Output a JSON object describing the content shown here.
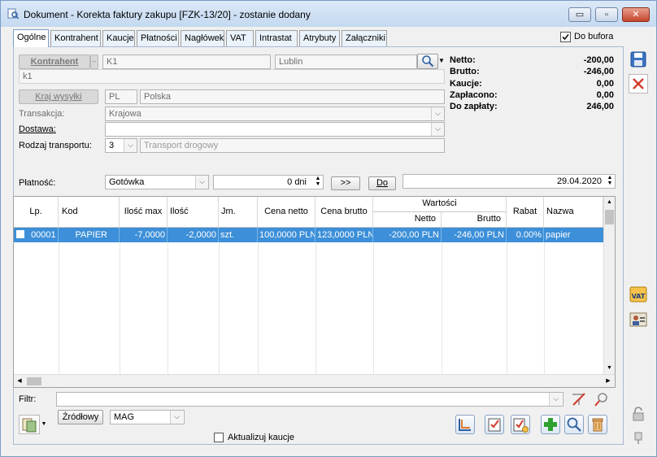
{
  "window": {
    "title": "Dokument - Korekta faktury zakupu [FZK-13/20]  - zostanie dodany",
    "minimize": "▭",
    "restore": "▫",
    "close": "✕"
  },
  "tabs": [
    "Ogólne",
    "Kontrahent",
    "Kaucje",
    "Płatności",
    "Nagłówek",
    "VAT",
    "Intrastat",
    "Atrybuty",
    "Załączniki"
  ],
  "do_bufora": {
    "label": "Do bufora",
    "checked": true
  },
  "kontrahent": {
    "button": "Kontrahent",
    "code": "K1",
    "city": "Lublin",
    "name": "k1"
  },
  "kraj": {
    "button": "Kraj wysyłki",
    "code": "PL",
    "name": "Polska"
  },
  "transakcja": {
    "label": "Transakcja:",
    "value": "Krajowa"
  },
  "dostawa": {
    "label": "Dostawa:",
    "value": ""
  },
  "transport": {
    "label": "Rodzaj transportu:",
    "code": "3",
    "value": "Transport drogowy"
  },
  "summary": [
    {
      "label": "Netto:",
      "value": "-200,00"
    },
    {
      "label": "Brutto:",
      "value": "-246,00"
    },
    {
      "label": "Kaucje:",
      "value": "0,00"
    },
    {
      "label": "Zapłacono:",
      "value": "0,00"
    },
    {
      "label": "Do zapłaty:",
      "value": "246,00"
    }
  ],
  "platnosc": {
    "label": "Płatność:",
    "method": "Gotówka",
    "days": "0 dni",
    "btn_next": ">>",
    "btn_do": "Do",
    "date": "29.04.2020"
  },
  "grid": {
    "headers": {
      "lp": "Lp.",
      "kod": "Kod",
      "ilosc_max": "Ilość max",
      "ilosc": "Ilość",
      "jm": "Jm.",
      "cena_netto": "Cena netto",
      "cena_brutto": "Cena brutto",
      "wartosci": "Wartości",
      "netto": "Netto",
      "brutto": "Brutto",
      "rabat": "Rabat",
      "nazwa": "Nazwa"
    },
    "rows": [
      {
        "lp": "00001",
        "kod": "PAPIER",
        "ilosc_max": "-7,0000",
        "ilosc": "-2,0000",
        "jm": "szt.",
        "cena_netto": "100,0000 PLN",
        "cena_brutto": "123,0000 PLN",
        "netto": "-200,00 PLN",
        "brutto": "-246,00 PLN",
        "rabat": "0.00%",
        "nazwa": "papier"
      }
    ]
  },
  "filtr": {
    "label": "Filtr:",
    "value": ""
  },
  "bottom": {
    "zrodlowy": "Źródłowy",
    "magazyn": "MAG",
    "aktualizuj": "Aktualizuj kaucje",
    "aktualizuj_checked": false
  },
  "colors": {
    "selection": "#3c8fd8",
    "add": "#2ea12e",
    "delete": "#d23b2b"
  }
}
